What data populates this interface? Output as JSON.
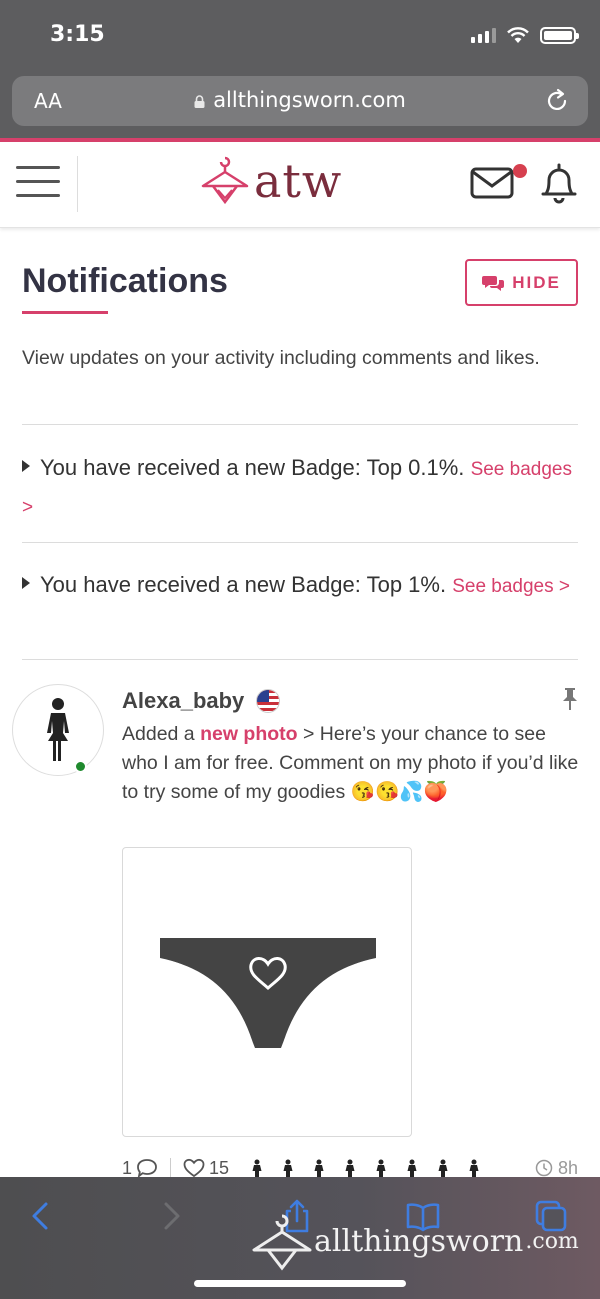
{
  "status_bar": {
    "time": "3:15"
  },
  "browser": {
    "aa_label": "AA",
    "url": "allthingsworn.com"
  },
  "header": {
    "logo_text": "atw",
    "unread_indicator": true
  },
  "page": {
    "title": "Notifications",
    "hide_button_label": "HIDE",
    "intro": "View updates on your activity including comments and likes."
  },
  "notifications": [
    {
      "text": "You have received a new Badge: Top 0.1%.",
      "link_text": "See badges >"
    },
    {
      "text": "You have received a new Badge: Top 1%.",
      "link_text": "See badges >"
    }
  ],
  "post": {
    "username": "Alexa_baby",
    "flag": "us-flag",
    "action_prefix": "Added a",
    "action_link": "new photo",
    "message": "> Here’s your chance to see who I am for free. Comment on my photo if you’d like to try some of my goodies 😘😘💦🍑",
    "comment_count": "1",
    "like_count": "15",
    "liker_count": 8,
    "time_ago": "8h"
  },
  "watermark": {
    "brand": "allthingsworn",
    "tld": ".com"
  },
  "colors": {
    "accent": "#d6406b",
    "logo": "#7a2d3d",
    "online": "#1f8a2e",
    "chrome": "#5d5d5f",
    "ios_blue": "#3f7de0"
  }
}
